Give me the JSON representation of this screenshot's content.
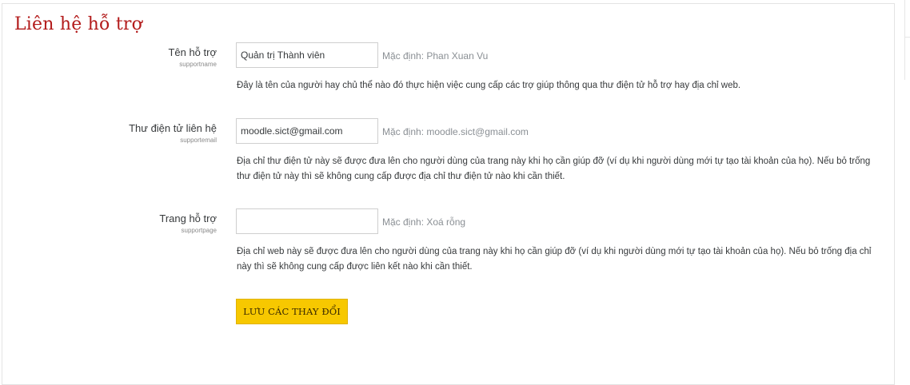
{
  "page": {
    "title": "Liên hệ hỗ trợ"
  },
  "settings": [
    {
      "label": "Tên hỗ trợ",
      "key": "supportname",
      "value": "Quản trị Thành viên",
      "default": "Mặc định: Phan Xuan Vu",
      "description": "Đây là tên của người hay chủ thể nào đó thực hiện việc cung cấp các trợ giúp thông qua thư điện tử hỗ trợ hay địa chỉ web."
    },
    {
      "label": "Thư điện tử liên hệ",
      "key": "supportemail",
      "value": "moodle.sict@gmail.com",
      "default": "Mặc định: moodle.sict@gmail.com",
      "description": "Địa chỉ thư điện tử này sẽ được đưa lên cho người dùng của trang này khi họ cần giúp đỡ (ví dụ khi người dùng mới tự tạo tài khoản của họ). Nếu bỏ trống thư điện tử này thì sẽ không cung cấp được địa chỉ thư điện tử nào khi cần thiết."
    },
    {
      "label": "Trang hỗ trợ",
      "key": "supportpage",
      "value": "",
      "default": "Mặc định: Xoá rỗng",
      "description": "Địa chỉ web này sẽ được đưa lên cho người dùng của trang này khi họ cần giúp đỡ (ví dụ khi người dùng mới tự tạo tài khoản của họ). Nếu bỏ trống địa chỉ này thì sẽ không cung cấp được liên kết nào khi cần thiết."
    }
  ],
  "actions": {
    "save_label": "LƯU CÁC THAY ĐỔI"
  },
  "colors": {
    "title": "#b31b1b",
    "save_button": "#f7c800"
  }
}
